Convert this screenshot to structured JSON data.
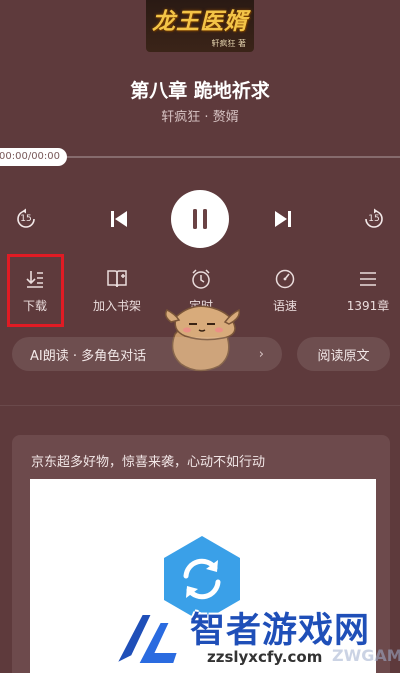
{
  "cover": {
    "title": "龙王医婿",
    "author": "轩疯狂 著"
  },
  "chapter": {
    "title": "第八章 跪地祈求",
    "meta": "轩疯狂 · 赘婿"
  },
  "player": {
    "time": "00:00/00:00",
    "progress": 0,
    "rewind_label": "15",
    "forward_label": "15"
  },
  "toolbar": {
    "items": [
      {
        "label": "下载",
        "icon": "download-icon"
      },
      {
        "label": "加入书架",
        "icon": "bookshelf-icon"
      },
      {
        "label": "定时",
        "icon": "clock-icon"
      },
      {
        "label": "语速",
        "icon": "speed-icon"
      },
      {
        "label": "1391章",
        "icon": "list-icon"
      }
    ]
  },
  "ai_pill": {
    "label": "AI朗读 · 多角色对话",
    "chevron": "›"
  },
  "read_original": "阅读原文",
  "ad": {
    "text": "京东超多好物，惊喜来袭，心动不如行动"
  },
  "watermark": {
    "title": "智者游戏网",
    "url": "zzslyxcfy.com",
    "faint": "ZWGAME"
  },
  "colors": {
    "background": "#5e3a3c",
    "highlight": "#e01b24",
    "ad_logo": "#3aa0e8",
    "watermark_blue": "#1f4fb8"
  }
}
